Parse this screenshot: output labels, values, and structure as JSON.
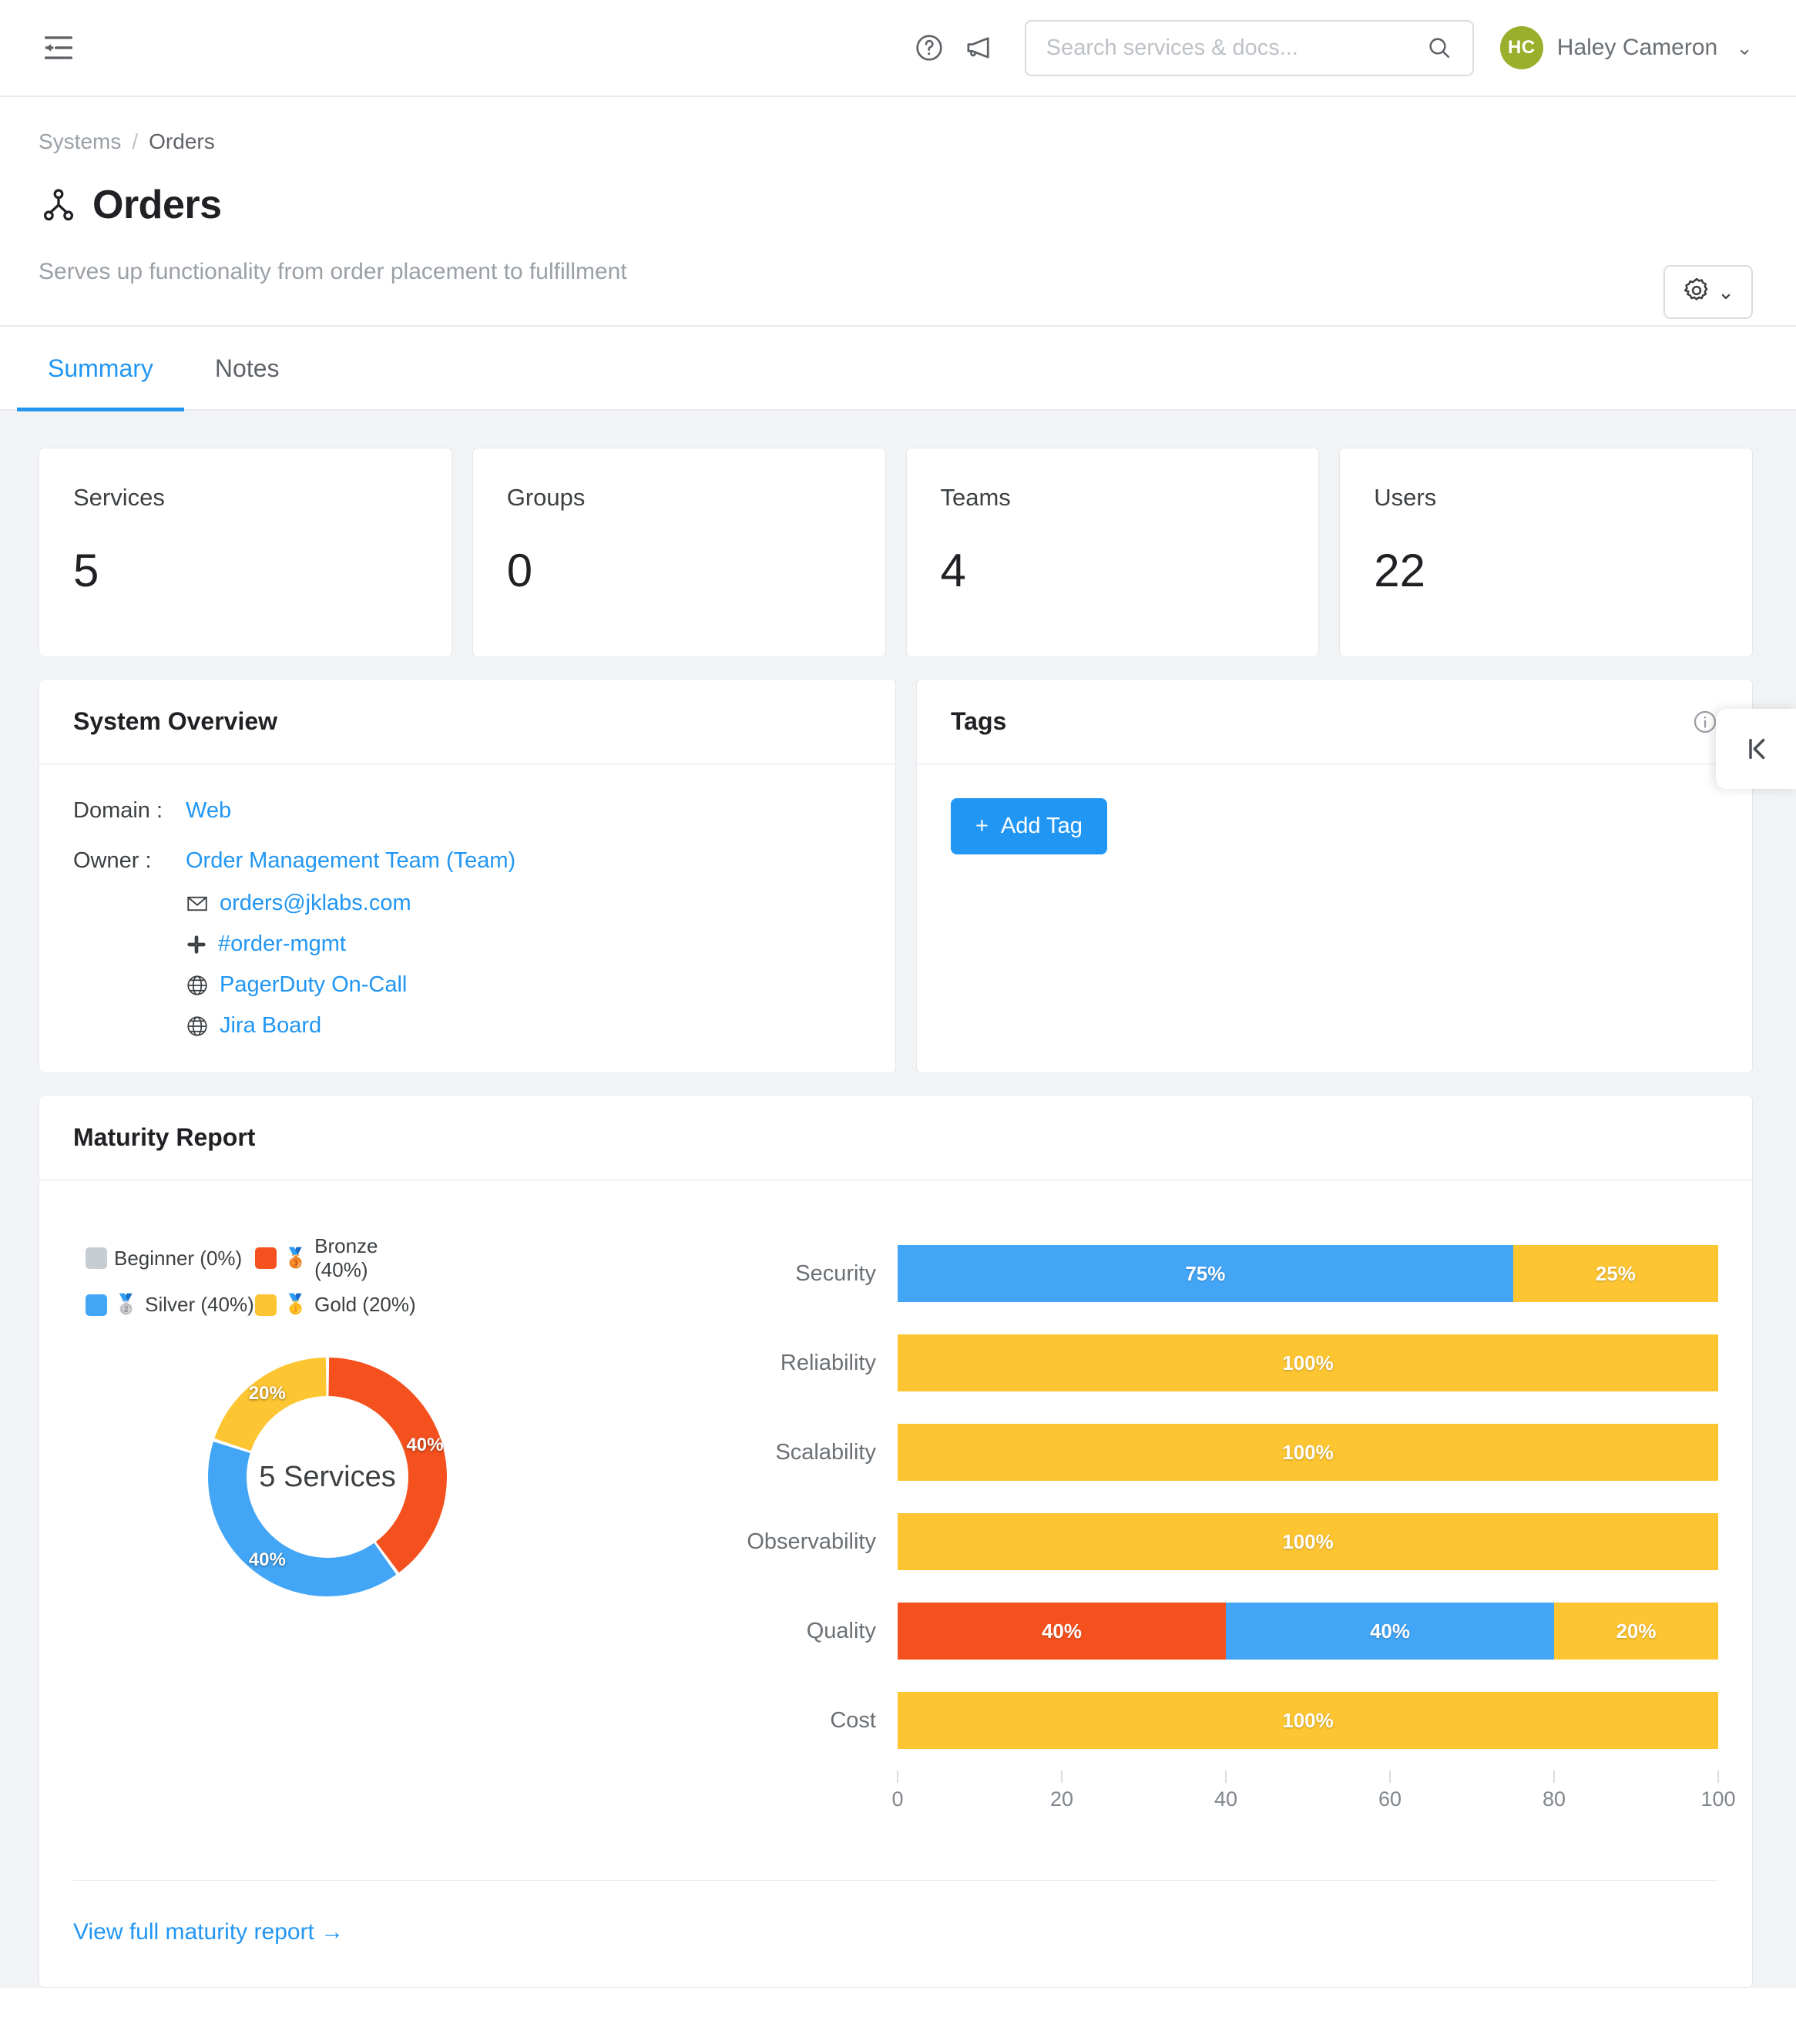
{
  "topbar": {
    "sidebar_toggle_name": "collapse-sidebar",
    "help_label": "Help",
    "announcements_label": "Announcements",
    "search": {
      "value": "",
      "placeholder": "Search services & docs..."
    },
    "user": {
      "initials": "HC",
      "name": "Haley Cameron",
      "caret": "⌄"
    }
  },
  "header": {
    "breadcrumb": {
      "parent": "Systems",
      "separator": "/",
      "current": "Orders"
    },
    "title": "Orders",
    "subtitle": "Serves up functionality from order placement to fulfillment",
    "settings_caret": "⌄"
  },
  "tabs": [
    {
      "label": "Summary",
      "active": true
    },
    {
      "label": "Notes",
      "active": false
    }
  ],
  "stats": [
    {
      "label": "Services",
      "value": "5"
    },
    {
      "label": "Groups",
      "value": "0"
    },
    {
      "label": "Teams",
      "value": "4"
    },
    {
      "label": "Users",
      "value": "22"
    }
  ],
  "overview": {
    "title": "System Overview",
    "domain_key": "Domain :",
    "domain_value": "Web",
    "owner_key": "Owner :",
    "owner_value": "Order Management Team (Team)",
    "links": [
      {
        "icon": "envelope-icon",
        "label": "orders@jklabs.com"
      },
      {
        "icon": "slack-icon",
        "label": "#order-mgmt"
      },
      {
        "icon": "globe-icon",
        "label": "PagerDuty On-Call"
      },
      {
        "icon": "globe-icon",
        "label": "Jira Board"
      }
    ]
  },
  "tags": {
    "title": "Tags",
    "info_icon": "info-icon",
    "add_button": "Add Tag",
    "add_button_plus": "+"
  },
  "collapse_panel": {
    "icon": "collapse-right-panel-icon"
  },
  "maturity": {
    "title": "Maturity Report",
    "footer_link": "View full maturity report →"
  },
  "colors": {
    "accent_blue": "#2196f3",
    "beginner": "#c7cdd2",
    "bronze": "#f4511e",
    "silver": "#42a5f5",
    "gold": "#fdc531",
    "avatar": "#9aaf2c"
  },
  "chart_data": [
    {
      "type": "pie",
      "name": "maturity-donut",
      "title": "5 Services",
      "center_label": "5 Services",
      "categories": [
        "Beginner",
        "Bronze",
        "Silver",
        "Gold"
      ],
      "values": [
        0,
        40,
        40,
        20
      ],
      "value_labels": [
        "0%",
        "40%",
        "40%",
        "20%"
      ],
      "colors": [
        "#c7cdd2",
        "#f4511e",
        "#42a5f5",
        "#fdc531"
      ],
      "legend": [
        {
          "label": "Beginner (0%)",
          "color": "#c7cdd2",
          "medal": ""
        },
        {
          "label": "Bronze (40%)",
          "color": "#f4511e",
          "medal": "🥉"
        },
        {
          "label": "Silver (40%)",
          "color": "#42a5f5",
          "medal": "🥈"
        },
        {
          "label": "Gold (20%)",
          "color": "#fdc531",
          "medal": "🥇"
        }
      ],
      "legend_position": "top-left"
    },
    {
      "type": "bar",
      "name": "maturity-by-category",
      "orientation": "horizontal",
      "stacked": true,
      "categories": [
        "Security",
        "Reliability",
        "Scalability",
        "Observability",
        "Quality",
        "Cost"
      ],
      "series": [
        {
          "name": "Beginner",
          "color": "#c7cdd2",
          "values": [
            0,
            0,
            0,
            0,
            0,
            0
          ]
        },
        {
          "name": "Bronze",
          "color": "#f4511e",
          "values": [
            0,
            0,
            0,
            0,
            40,
            0
          ]
        },
        {
          "name": "Silver",
          "color": "#42a5f5",
          "values": [
            75,
            0,
            0,
            0,
            40,
            0
          ]
        },
        {
          "name": "Gold",
          "color": "#fdc531",
          "values": [
            25,
            100,
            100,
            100,
            20,
            100
          ]
        }
      ],
      "rows": [
        {
          "label": "Security",
          "segments": [
            {
              "label": "75%",
              "value": 75,
              "color": "#42a5f5"
            },
            {
              "label": "25%",
              "value": 25,
              "color": "#fdc531"
            }
          ]
        },
        {
          "label": "Reliability",
          "segments": [
            {
              "label": "100%",
              "value": 100,
              "color": "#fdc531"
            }
          ]
        },
        {
          "label": "Scalability",
          "segments": [
            {
              "label": "100%",
              "value": 100,
              "color": "#fdc531"
            }
          ]
        },
        {
          "label": "Observability",
          "segments": [
            {
              "label": "100%",
              "value": 100,
              "color": "#fdc531"
            }
          ]
        },
        {
          "label": "Quality",
          "segments": [
            {
              "label": "40%",
              "value": 40,
              "color": "#f4511e"
            },
            {
              "label": "40%",
              "value": 40,
              "color": "#42a5f5"
            },
            {
              "label": "20%",
              "value": 20,
              "color": "#fdc531"
            }
          ]
        },
        {
          "label": "Cost",
          "segments": [
            {
              "label": "100%",
              "value": 100,
              "color": "#fdc531"
            }
          ]
        }
      ],
      "xticks": [
        0,
        20,
        40,
        60,
        80,
        100
      ],
      "xtick_labels": [
        "0",
        "20",
        "40",
        "60",
        "80",
        "100"
      ],
      "xlim": [
        0,
        100
      ],
      "xlabel": "",
      "ylabel": "",
      "grid": false
    }
  ]
}
